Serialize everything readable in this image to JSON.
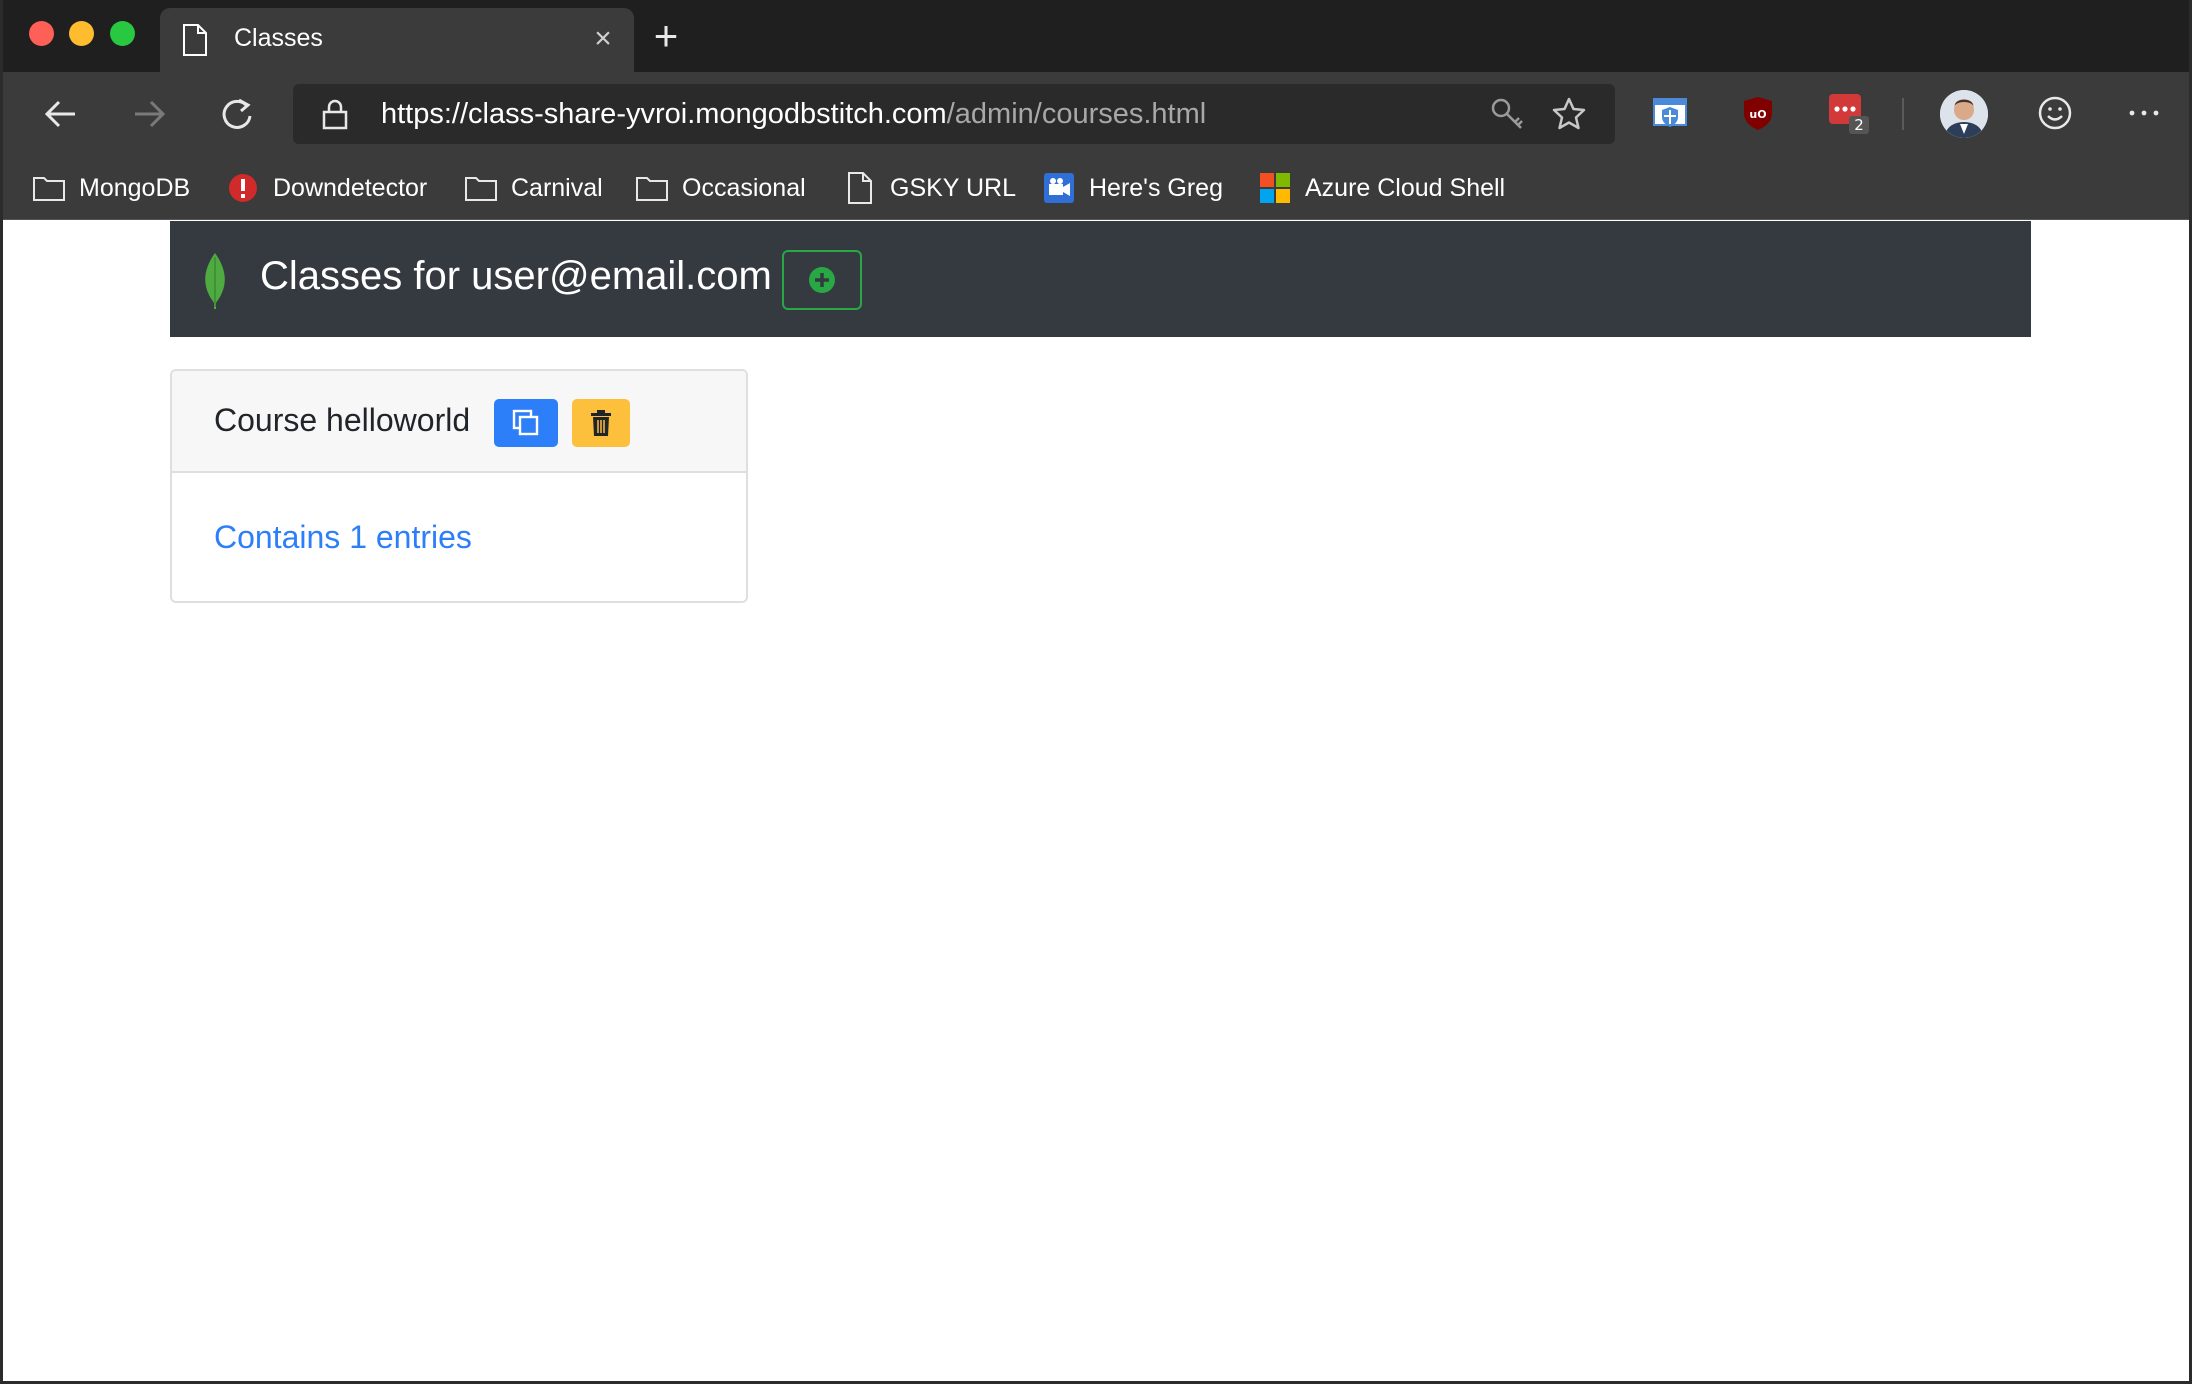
{
  "browser": {
    "tab_title": "Classes",
    "url_host": "https://class-share-yvroi.mongodbstitch.com",
    "url_path": "/admin/courses.html",
    "extension_badge": "2"
  },
  "bookmarks": [
    {
      "label": "MongoDB",
      "icon": "folder-icon"
    },
    {
      "label": "Downdetector",
      "icon": "alert-icon"
    },
    {
      "label": "Carnival",
      "icon": "folder-icon"
    },
    {
      "label": "Occasional",
      "icon": "folder-icon"
    },
    {
      "label": "GSKY URL",
      "icon": "page-icon"
    },
    {
      "label": "Here's Greg",
      "icon": "video-icon"
    },
    {
      "label": "Azure Cloud Shell",
      "icon": "microsoft-icon"
    }
  ],
  "app": {
    "title": "Classes for user@email.com"
  },
  "courses": [
    {
      "title": "Course helloworld",
      "entries_text": "Contains 1 entries"
    }
  ],
  "colors": {
    "header_bg": "#343a40",
    "accent_green": "#28a745",
    "primary_blue": "#2d7ff9",
    "warning_yellow": "#fcc03d"
  }
}
